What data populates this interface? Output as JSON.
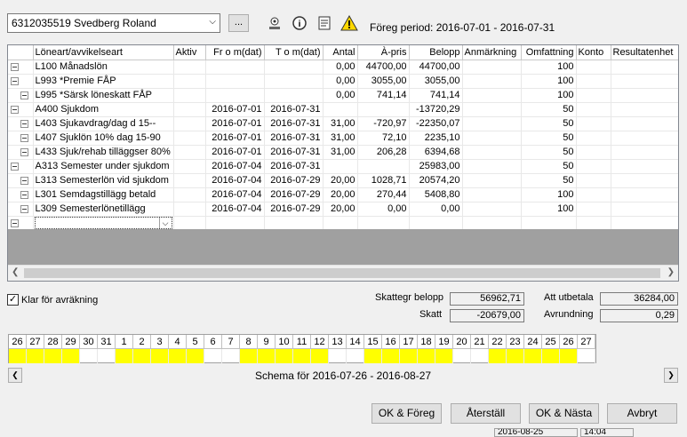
{
  "header": {
    "employee": "6312035519   Svedberg Roland",
    "ellipsis_label": "...",
    "period_label": "Föreg period: 2016-07-01 - 2016-07-31"
  },
  "grid": {
    "columns": [
      "Löneart/avvikelseart",
      "Aktiv",
      "Fr o m(dat)",
      "T o m(dat)",
      "Antal",
      "À-pris",
      "Belopp",
      "Anmärkning",
      "Omfattning",
      "Konto",
      "Resultatenhet"
    ],
    "rows": [
      {
        "level": 0,
        "label": "L100 Månadslön",
        "aktiv": "",
        "from": "",
        "tom": "",
        "antal": "0,00",
        "apris": "44700,00",
        "belopp": "44700,00",
        "anm": "",
        "omf": "100",
        "konto": "",
        "res": ""
      },
      {
        "level": 0,
        "label": "L993 *Premie FÅP",
        "aktiv": "",
        "from": "",
        "tom": "",
        "antal": "0,00",
        "apris": "3055,00",
        "belopp": "3055,00",
        "anm": "",
        "omf": "100",
        "konto": "",
        "res": ""
      },
      {
        "level": 1,
        "label": "L995 *Särsk löneskatt FÅP",
        "aktiv": "",
        "from": "",
        "tom": "",
        "antal": "0,00",
        "apris": "741,14",
        "belopp": "741,14",
        "anm": "",
        "omf": "100",
        "konto": "",
        "res": ""
      },
      {
        "level": 0,
        "label": "A400 Sjukdom",
        "aktiv": "",
        "from": "2016-07-01",
        "tom": "2016-07-31",
        "antal": "",
        "apris": "",
        "belopp": "-13720,29",
        "anm": "",
        "omf": "50",
        "konto": "",
        "res": ""
      },
      {
        "level": 1,
        "label": "L403 Sjukavdrag/dag d 15--",
        "aktiv": "",
        "from": "2016-07-01",
        "tom": "2016-07-31",
        "antal": "31,00",
        "apris": "-720,97",
        "belopp": "-22350,07",
        "anm": "",
        "omf": "50",
        "konto": "",
        "res": ""
      },
      {
        "level": 1,
        "label": "L407 Sjuklön 10% dag 15-90",
        "aktiv": "",
        "from": "2016-07-01",
        "tom": "2016-07-31",
        "antal": "31,00",
        "apris": "72,10",
        "belopp": "2235,10",
        "anm": "",
        "omf": "50",
        "konto": "",
        "res": ""
      },
      {
        "level": 1,
        "label": "L433 Sjuk/rehab tilläggser 80%",
        "aktiv": "",
        "from": "2016-07-01",
        "tom": "2016-07-31",
        "antal": "31,00",
        "apris": "206,28",
        "belopp": "6394,68",
        "anm": "",
        "omf": "50",
        "konto": "",
        "res": ""
      },
      {
        "level": 0,
        "label": "A313 Semester under sjukdom",
        "aktiv": "",
        "from": "2016-07-04",
        "tom": "2016-07-31",
        "antal": "",
        "apris": "",
        "belopp": "25983,00",
        "anm": "",
        "omf": "50",
        "konto": "",
        "res": ""
      },
      {
        "level": 1,
        "label": "L313 Semesterlön vid sjukdom",
        "aktiv": "",
        "from": "2016-07-04",
        "tom": "2016-07-29",
        "antal": "20,00",
        "apris": "1028,71",
        "belopp": "20574,20",
        "anm": "",
        "omf": "50",
        "konto": "",
        "res": ""
      },
      {
        "level": 1,
        "label": "L301 Semdagstillägg betald",
        "aktiv": "",
        "from": "2016-07-04",
        "tom": "2016-07-29",
        "antal": "20,00",
        "apris": "270,44",
        "belopp": "5408,80",
        "anm": "",
        "omf": "100",
        "konto": "",
        "res": ""
      },
      {
        "level": 1,
        "label": "L309 Semesterlönetillägg",
        "aktiv": "",
        "from": "2016-07-04",
        "tom": "2016-07-29",
        "antal": "20,00",
        "apris": "0,00",
        "belopp": "0,00",
        "anm": "",
        "omf": "100",
        "konto": "",
        "res": ""
      }
    ]
  },
  "summary": {
    "klar_label": "Klar för avräkning",
    "skattegr_label": "Skattegr belopp",
    "skattegr_value": "56962,71",
    "skatt_label": "Skatt",
    "skatt_value": "-20679,00",
    "att_utbetala_label": "Att utbetala",
    "att_utbetala_value": "36284,00",
    "avrundning_label": "Avrundning",
    "avrundning_value": "0,29"
  },
  "calendar": {
    "days": [
      "26",
      "27",
      "28",
      "29",
      "30",
      "31",
      "1",
      "2",
      "3",
      "4",
      "5",
      "6",
      "7",
      "8",
      "9",
      "10",
      "11",
      "12",
      "13",
      "14",
      "15",
      "16",
      "17",
      "18",
      "19",
      "20",
      "21",
      "22",
      "23",
      "24",
      "25",
      "26",
      "27"
    ],
    "scheduled": [
      1,
      1,
      1,
      1,
      0,
      0,
      1,
      1,
      1,
      1,
      1,
      0,
      0,
      1,
      1,
      1,
      1,
      1,
      0,
      0,
      1,
      1,
      1,
      1,
      1,
      0,
      0,
      1,
      1,
      1,
      1,
      1,
      0
    ],
    "schema_label": "Schema för 2016-07-26 - 2016-08-27"
  },
  "buttons": {
    "ok_foreg": "OK & Föreg",
    "aterstall": "Återställ",
    "ok_nasta": "OK & Nästa",
    "avbryt": "Avbryt"
  },
  "statusbar": {
    "date": "2016-08-25",
    "time": "14:04"
  }
}
